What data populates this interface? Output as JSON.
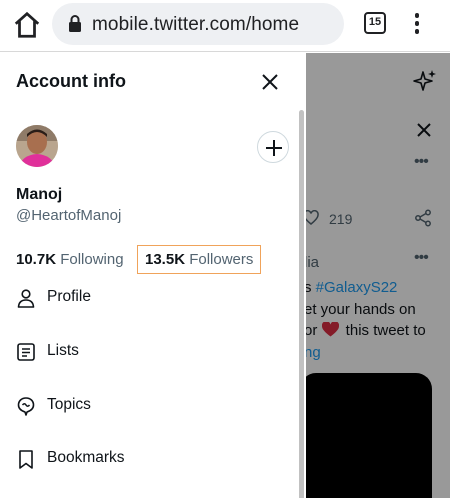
{
  "browser": {
    "url": "mobile.twitter.com/home",
    "tab_count": "15"
  },
  "timeline": {
    "like_count": "219",
    "tweet_lines": [
      "lia",
      "s #GalaxyS22",
      "et your hands on",
      "or  this tweet to",
      "ng"
    ],
    "hashtag": "#GalaxyS22",
    "line2_prefix": "s ",
    "line4_prefix": "or ",
    "line4_suffix": " this tweet to",
    "link_fragment": "ng"
  },
  "drawer": {
    "title": "Account info",
    "display_name": "Manoj",
    "handle": "@HeartofManoj",
    "following_count": "10.7K",
    "following_label": "Following",
    "followers_count": "13.5K",
    "followers_label": "Followers",
    "menu": [
      {
        "label": "Profile",
        "icon": "person-icon"
      },
      {
        "label": "Lists",
        "icon": "lists-icon"
      },
      {
        "label": "Topics",
        "icon": "topics-icon"
      },
      {
        "label": "Bookmarks",
        "icon": "bookmark-icon"
      }
    ]
  },
  "colors": {
    "highlight_box": "#f0a35a",
    "link_blue": "#1d9bf0",
    "muted_text": "#536471"
  }
}
